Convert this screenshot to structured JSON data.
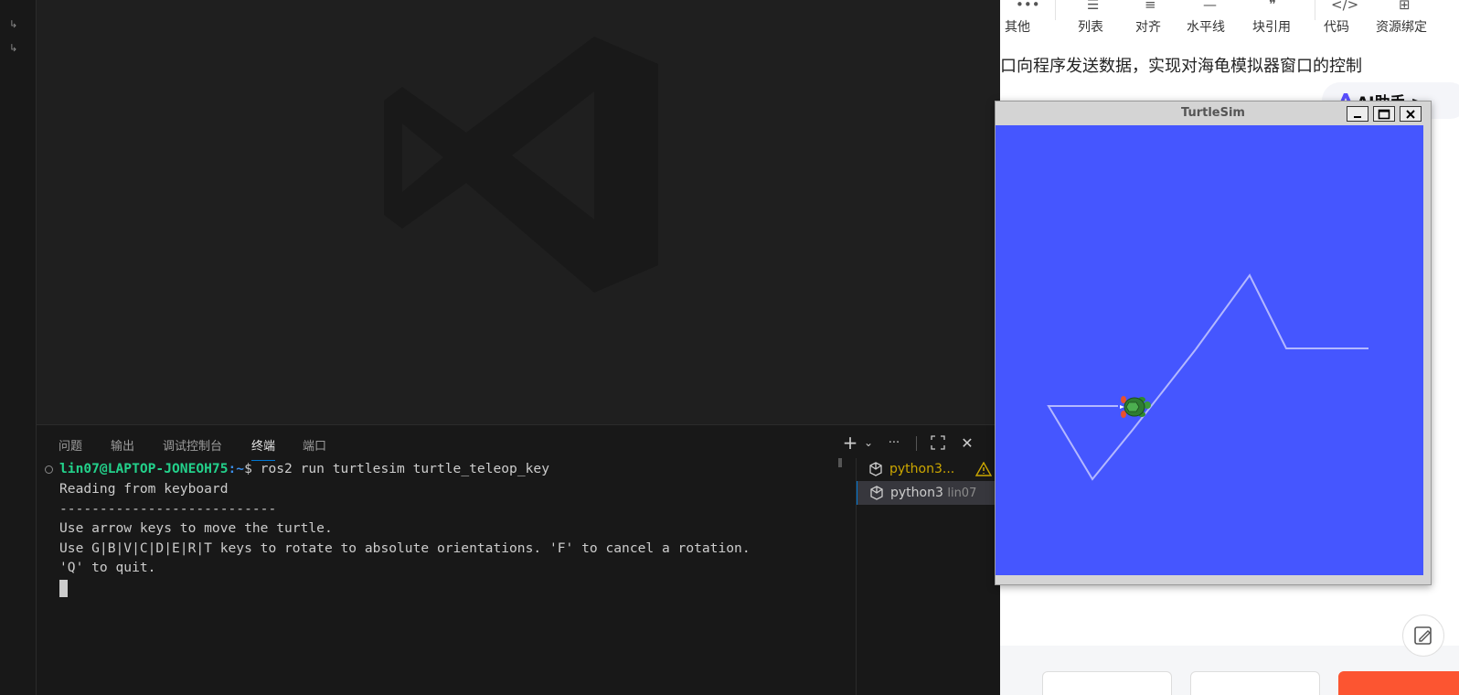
{
  "vscode": {
    "activity_glyphs": [
      "↳",
      "↳"
    ],
    "panel_tabs": [
      {
        "label": "问题",
        "active": false
      },
      {
        "label": "输出",
        "active": false
      },
      {
        "label": "调试控制台",
        "active": false
      },
      {
        "label": "终端",
        "active": true
      },
      {
        "label": "端口",
        "active": false
      }
    ],
    "panel_actions": {
      "add": "+",
      "dropdown": "⌄",
      "more": "···",
      "maximize": "⛶",
      "close": "✕"
    },
    "terminal": {
      "user_host": "lin07@LAPTOP-JONEOH75",
      "path": ":~",
      "prompt_symbol": "$",
      "command": " ros2 run turtlesim turtle_teleop_key",
      "output": [
        "Reading from keyboard",
        "---------------------------",
        "Use arrow keys to move the turtle.",
        "Use G|B|V|C|D|E|R|T keys to rotate to absolute orientations. 'F' to cancel a rotation.",
        "'Q' to quit."
      ]
    },
    "terminal_list": [
      {
        "name": "python3...",
        "sub": "",
        "warning": true,
        "selected": false
      },
      {
        "name": "python3",
        "sub": "lin07",
        "warning": false,
        "selected": true
      }
    ]
  },
  "browser": {
    "toolbar": [
      {
        "label": "其他",
        "icon": "more-dots-icon"
      },
      {
        "label": "列表",
        "icon": "list-icon"
      },
      {
        "label": "对齐",
        "icon": "align-icon"
      },
      {
        "label": "水平线",
        "icon": "horizontal-rule-icon"
      },
      {
        "label": "块引用",
        "icon": "quote-icon"
      },
      {
        "label": "代码",
        "icon": "code-icon"
      },
      {
        "label": "资源绑定",
        "icon": "resource-icon"
      }
    ],
    "article_line": "口向程序发送数据，实现对海龟模拟器窗口的控制",
    "ai_button": "AI助手 >"
  },
  "turtlesim": {
    "title": "TurtleSim",
    "background": "#4556ff",
    "pen_color": "#b3b8ff",
    "buttons": {
      "minimize": "_",
      "maximize": "□",
      "close": "✕"
    }
  },
  "colors": {
    "accent": "#0078d4",
    "prompt_user": "#23d18b",
    "prompt_path": "#3b8eea",
    "warning": "#cca700",
    "csdn_red": "#fc5531"
  }
}
